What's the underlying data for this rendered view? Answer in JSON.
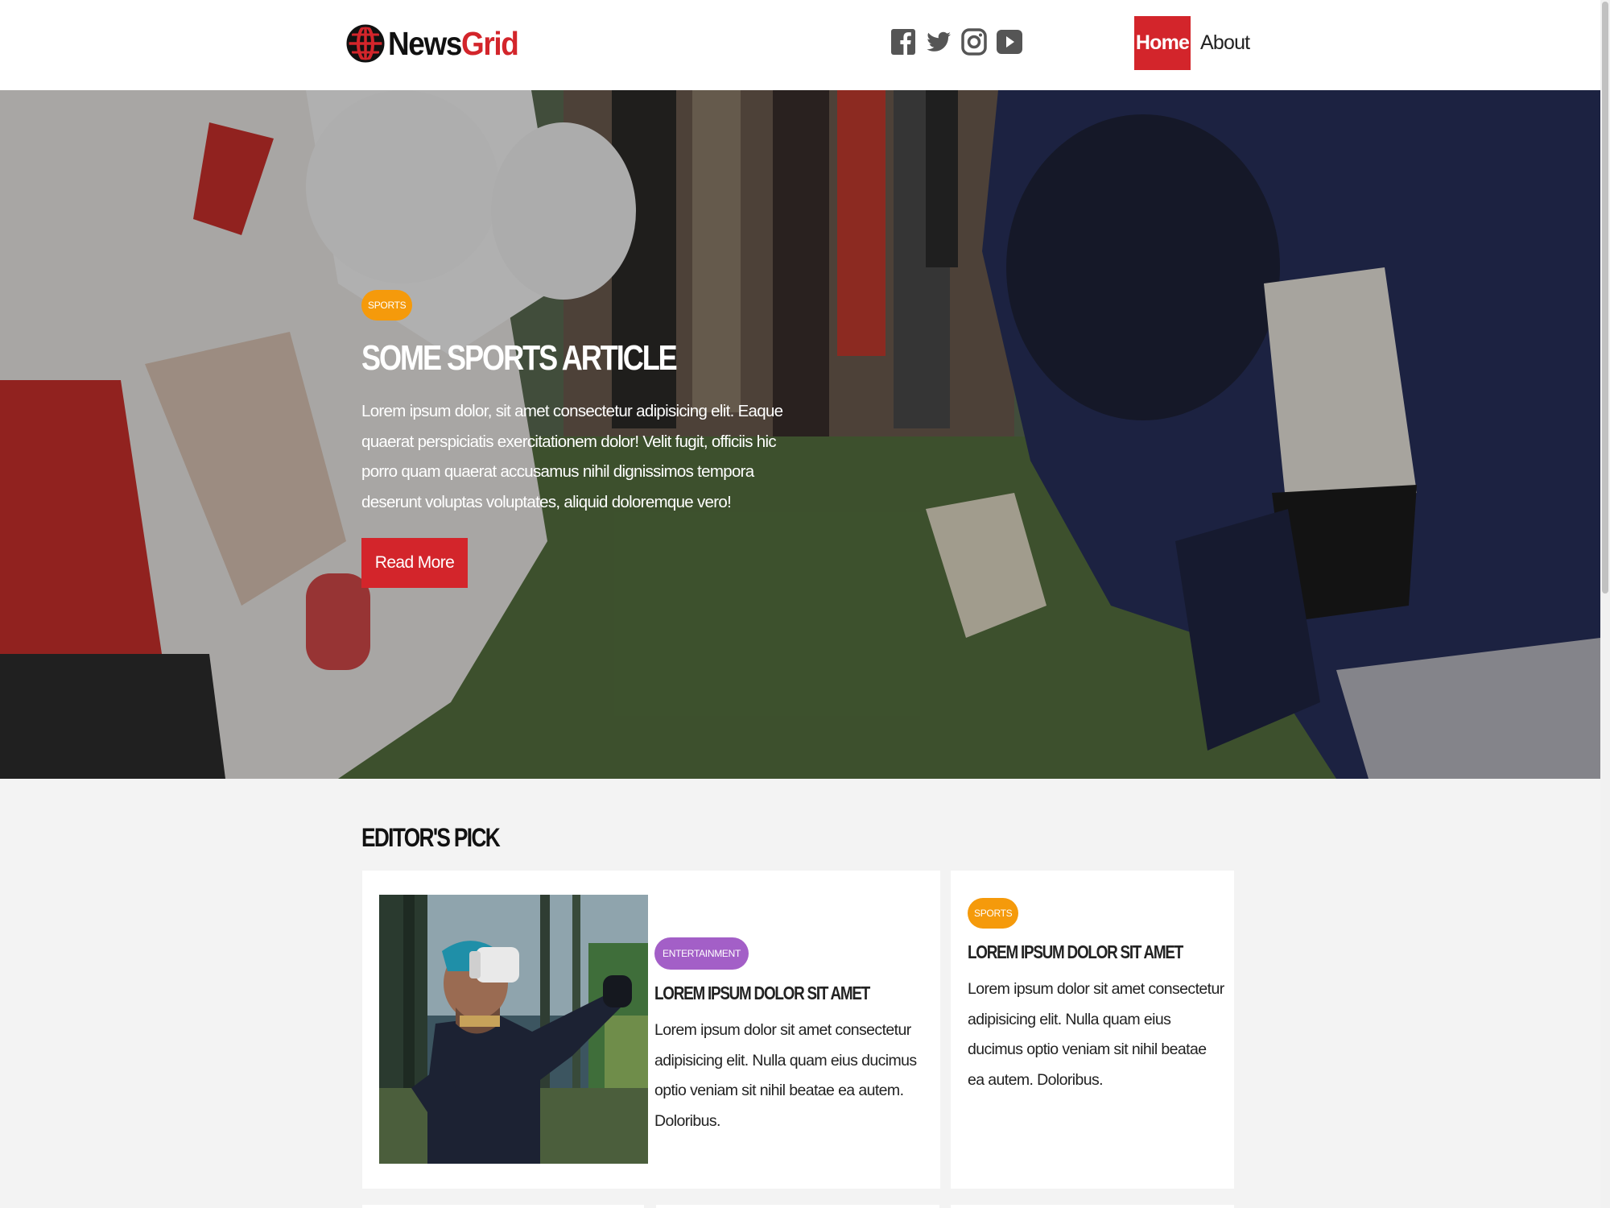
{
  "header": {
    "logo": {
      "part1": "News",
      "part2": "Grid"
    },
    "socials": [
      {
        "icon": "facebook-icon"
      },
      {
        "icon": "twitter-icon"
      },
      {
        "icon": "instagram-icon"
      },
      {
        "icon": "youtube-icon"
      }
    ],
    "nav": [
      {
        "label": "Home",
        "active": true
      },
      {
        "label": "About",
        "active": false
      }
    ]
  },
  "hero": {
    "category": "SPORTS",
    "title": "Some Sports Article",
    "text": "Lorem ipsum dolor, sit amet consectetur adipisicing elit. Eaque quaerat perspiciatis exercitationem dolor! Velit fugit, officiis hic porro quam quaerat accusamus nihil dignissimos tempora deserunt voluptas voluptates, aliquid doloremque vero!",
    "button": "Read More"
  },
  "editors_pick": {
    "title": "Editor's Pick",
    "cards": [
      {
        "category": "ENTERTAINMENT",
        "title": "Lorem ipsum dolor sit amet",
        "text": "Lorem ipsum dolor sit amet consectetur adipisicing elit. Nulla quam eius ducimus optio veniam sit nihil beatae ea autem. Doloribus."
      },
      {
        "category": "SPORTS",
        "title": "Lorem ipsum dolor sit amet",
        "text": "Lorem ipsum dolor sit amet consectetur adipisicing elit. Nulla quam eius ducimus optio veniam sit nihil beatae ea autem. Doloribus."
      }
    ]
  },
  "colors": {
    "accent": "#d3252b",
    "sports_badge": "#f59a0b",
    "entertainment_badge": "#a35fc7"
  }
}
